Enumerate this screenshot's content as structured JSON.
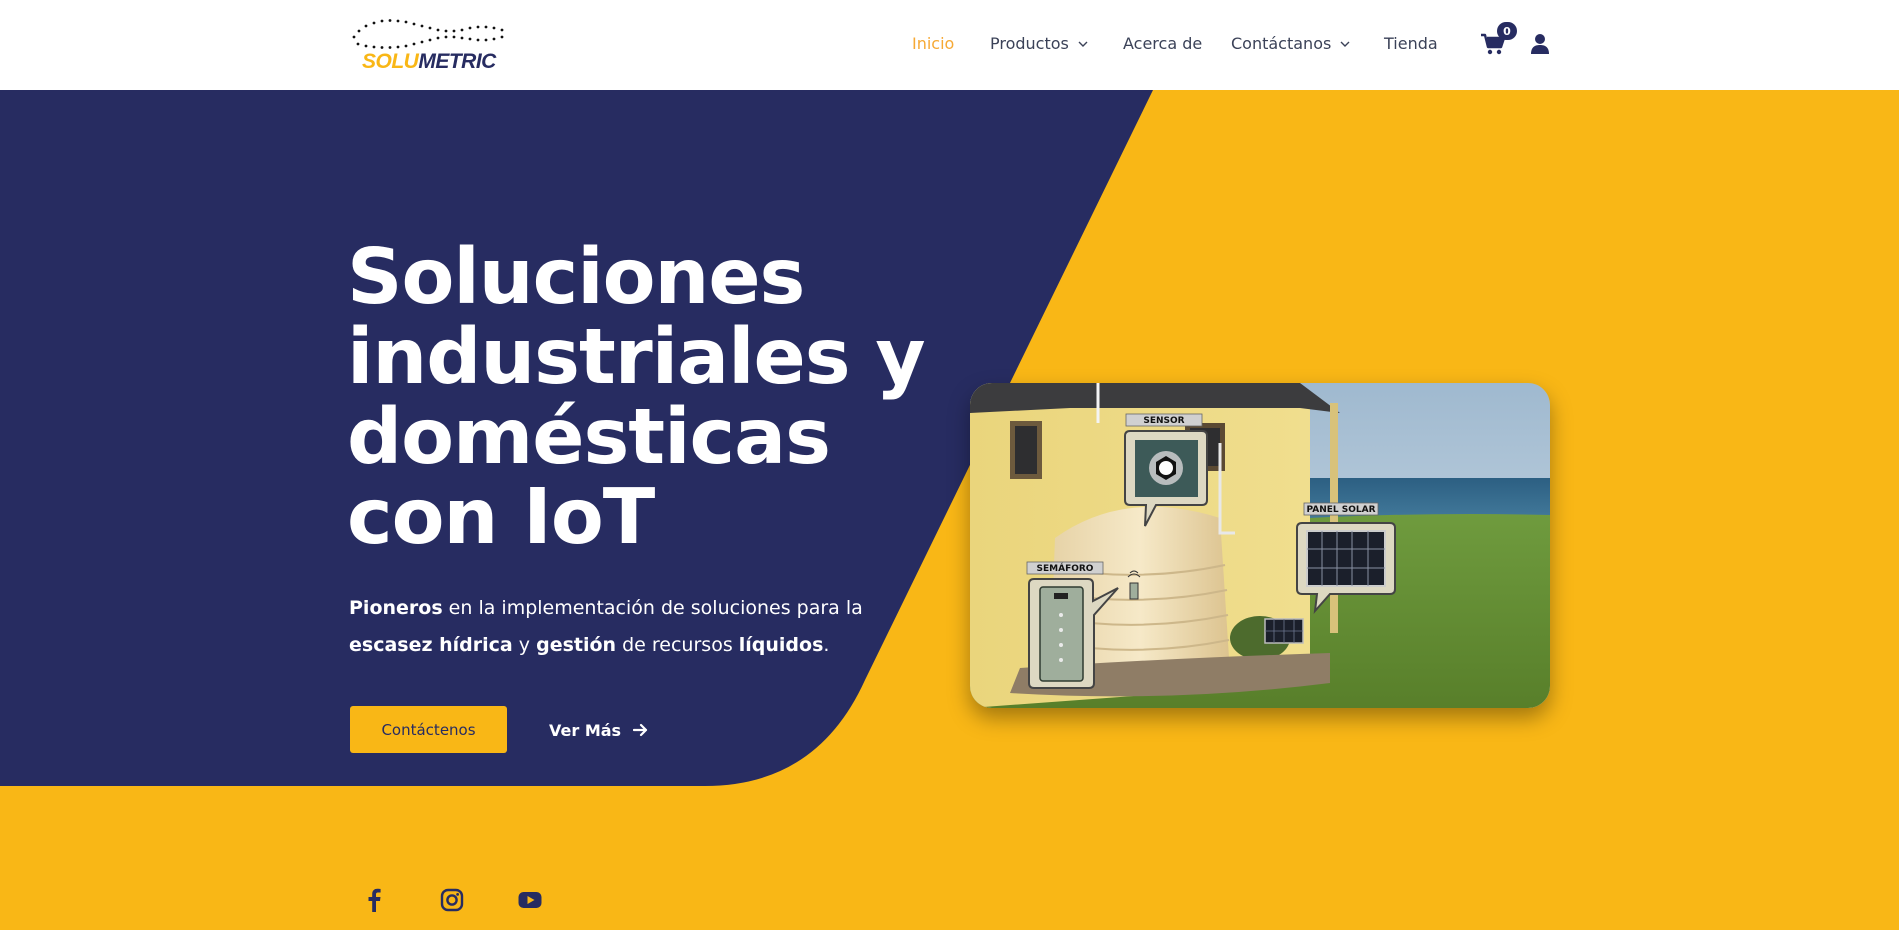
{
  "brand": {
    "logo_part1": "SOLU",
    "logo_part2": "METRIC"
  },
  "nav": {
    "items": [
      {
        "label": "Inicio",
        "active": true,
        "dropdown": false
      },
      {
        "label": "Productos",
        "active": false,
        "dropdown": true
      },
      {
        "label": "Acerca de",
        "active": false,
        "dropdown": false
      },
      {
        "label": "Contáctanos",
        "active": false,
        "dropdown": true
      },
      {
        "label": "Tienda",
        "active": false,
        "dropdown": false
      }
    ],
    "cart_count": "0",
    "cart_icon": "shopping-cart-icon",
    "user_icon": "user-icon"
  },
  "hero": {
    "title": "Soluciones industriales y domésticas con IoT",
    "subtitle": {
      "w1": "Pioneros",
      "t1": " en la implementación de soluciones para la ",
      "w2": "escasez hídrica",
      "t2": " y ",
      "w3": "gestión",
      "t3": " de recursos ",
      "w4": "líquidos",
      "t4": "."
    },
    "cta_primary": "Contáctenos",
    "cta_secondary": "Ver Más"
  },
  "illustration": {
    "labels": {
      "sensor": "SENSOR",
      "panel": "PANEL SOLAR",
      "semaforo": "SEMÁFORO"
    }
  },
  "social": [
    "facebook-icon",
    "instagram-icon",
    "youtube-icon"
  ],
  "colors": {
    "navy": "#272c61",
    "yellow": "#f9b716",
    "active_nav": "#f6a935",
    "white": "#ffffff"
  }
}
